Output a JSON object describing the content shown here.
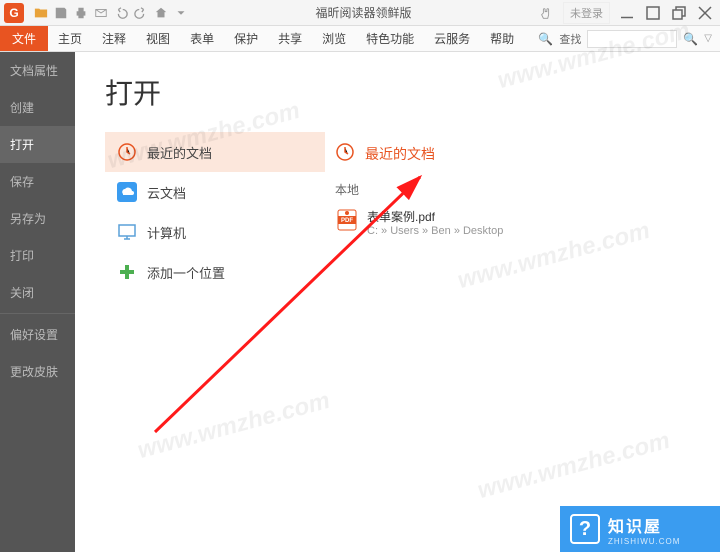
{
  "titlebar": {
    "app_title": "福昕阅读器领鲜版",
    "login": "未登录"
  },
  "ribbon": {
    "file": "文件",
    "tabs": [
      "主页",
      "注释",
      "视图",
      "表单",
      "保护",
      "共享",
      "浏览",
      "特色功能",
      "云服务",
      "帮助"
    ],
    "search_label": "查找",
    "search_placeholder": " "
  },
  "sidebar": {
    "items": [
      {
        "label": "文档属性"
      },
      {
        "label": "创建"
      },
      {
        "label": "打开"
      },
      {
        "label": "保存"
      },
      {
        "label": "另存为"
      },
      {
        "label": "打印"
      },
      {
        "label": "关闭"
      }
    ],
    "bottom": [
      {
        "label": "偏好设置"
      },
      {
        "label": "更改皮肤"
      }
    ]
  },
  "content": {
    "title": "打开",
    "options": {
      "recent": "最近的文档",
      "cloud": "云文档",
      "computer": "计算机",
      "add": "添加一个位置"
    },
    "right_header": "最近的文档",
    "section": "本地",
    "file": {
      "name": "表单案例.pdf",
      "path": "C: » Users » Ben » Desktop"
    }
  },
  "brand": {
    "main": "知识屋",
    "sub": "ZHISHIWU.COM",
    "icon": "?"
  },
  "watermark": "www.wmzhe.com"
}
